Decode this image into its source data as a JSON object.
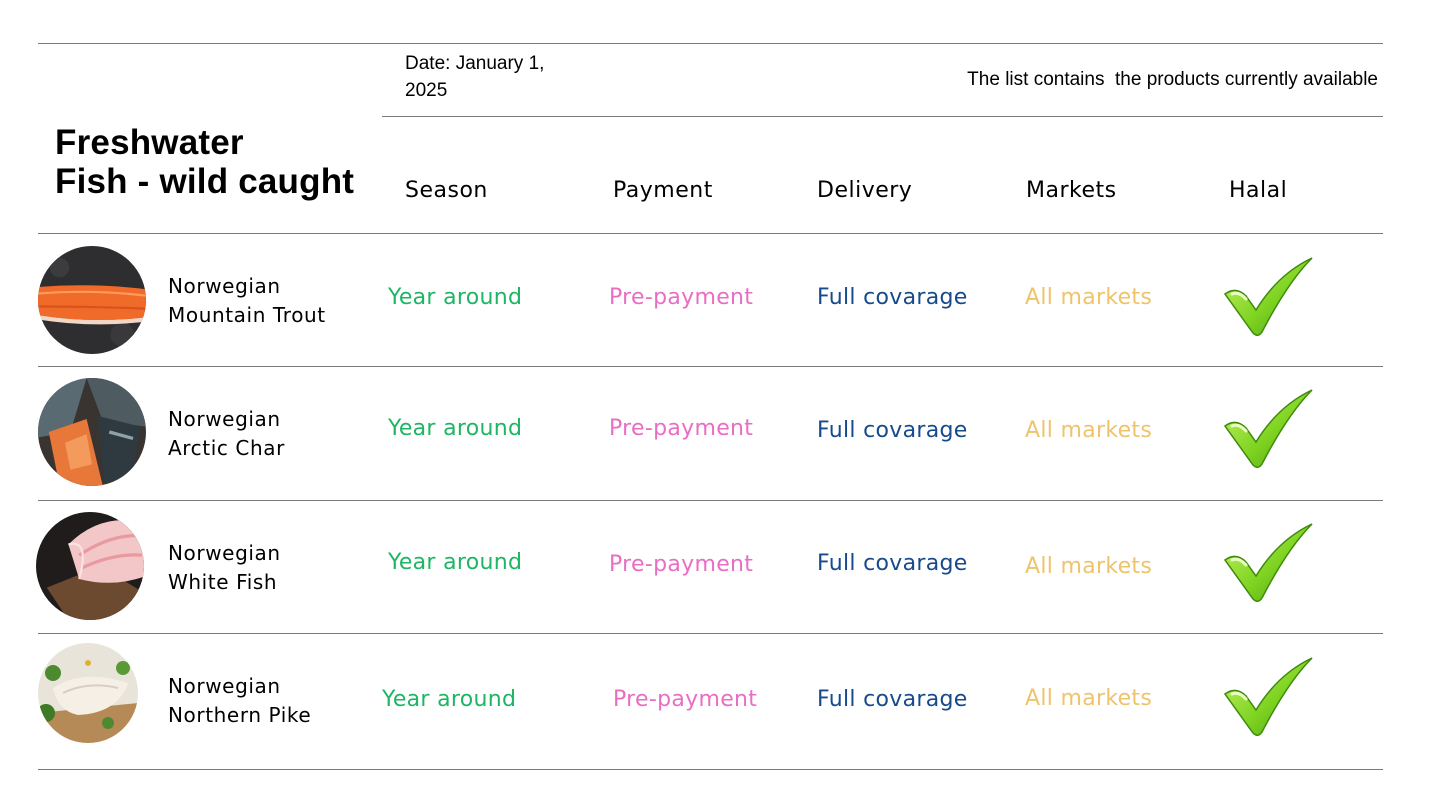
{
  "header": {
    "title": "Freshwater Fish - wild caught",
    "title_line1": "Freshwater",
    "title_line2": "Fish - wild caught",
    "date_line1": "Date: January 1,",
    "date_line2": "2025",
    "note": "The list contains  the products currently available"
  },
  "columns": [
    "Season",
    "Payment",
    "Delivery",
    "Markets",
    "Halal"
  ],
  "rows": [
    {
      "name_line1": "Norwegian",
      "name_line2": "Mountain Trout",
      "image": "trout-fillet-image",
      "season": "Year around",
      "payment": "Pre-payment",
      "delivery": "Full covarage",
      "markets": "All markets",
      "halal": "checkmark-icon"
    },
    {
      "name_line1": "Norwegian",
      "name_line2": "Arctic Char",
      "image": "arctic-char-image",
      "season": "Year around",
      "payment": "Pre-payment",
      "delivery": "Full covarage",
      "markets": "All markets",
      "halal": "checkmark-icon"
    },
    {
      "name_line1": "Norwegian",
      "name_line2": "White Fish",
      "image": "white-fish-image",
      "season": "Year around",
      "payment": "Pre-payment",
      "delivery": "Full covarage",
      "markets": "All markets",
      "halal": "checkmark-icon"
    },
    {
      "name_line1": "Norwegian",
      "name_line2": "Northern Pike",
      "image": "northern-pike-image",
      "season": "Year around",
      "payment": "Pre-payment",
      "delivery": "Full covarage",
      "markets": "All markets",
      "halal": "checkmark-icon"
    }
  ],
  "colors": {
    "season": "#1db664",
    "payment": "#ea6dc4",
    "delivery": "#174a8c",
    "markets": "#efc36b",
    "check": "#7ed321"
  }
}
